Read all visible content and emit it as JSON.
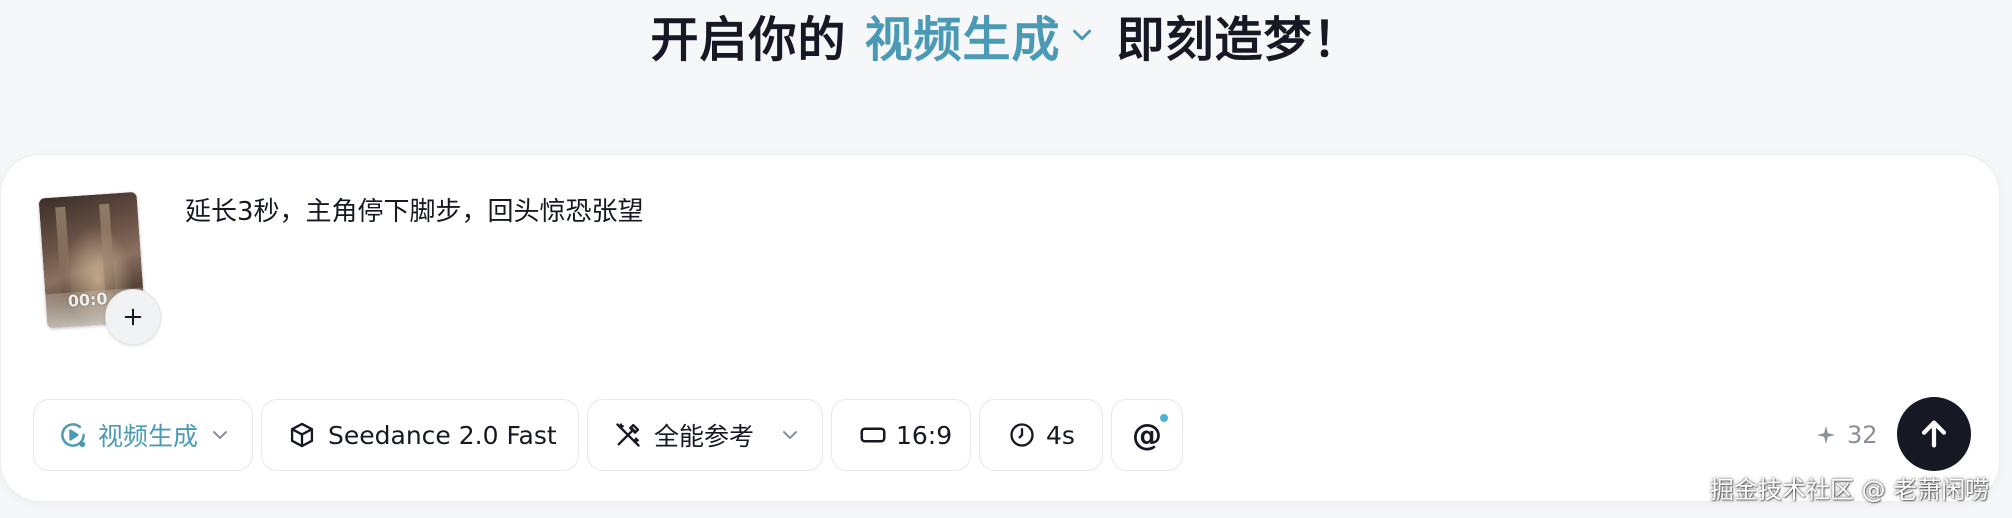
{
  "headline": {
    "prefix": "开启你的",
    "mode": "视频生成",
    "suffix": "即刻造梦！"
  },
  "prompt": {
    "reference_thumbnail": {
      "timestamp": "00:0"
    },
    "text": "延长3秒，主角停下脚步，回头惊恐张望"
  },
  "toolbar": {
    "mode_label": "视频生成",
    "model_label": "Seedance 2.0 Fast",
    "reference_label": "全能参考",
    "ratio_label": "16:9",
    "duration_label": "4s",
    "mention_label": "@",
    "credits": "32"
  },
  "watermark": "掘金技术社区 @ 老萧闲唠",
  "icons": {
    "chevron": "chevron-down-icon",
    "mode": "video-play-icon",
    "model": "cube-icon",
    "reference": "magic-pen-icon",
    "ratio": "aspect-ratio-icon",
    "duration": "clock-icon",
    "credits": "sparkle-icon",
    "submit": "arrow-up-icon",
    "add": "plus-icon"
  },
  "colors": {
    "accent": "#4a9ab5",
    "text": "#161823",
    "muted": "#8a8f99",
    "submit_bg": "#161823",
    "notify_dot": "#4cb3d6"
  }
}
